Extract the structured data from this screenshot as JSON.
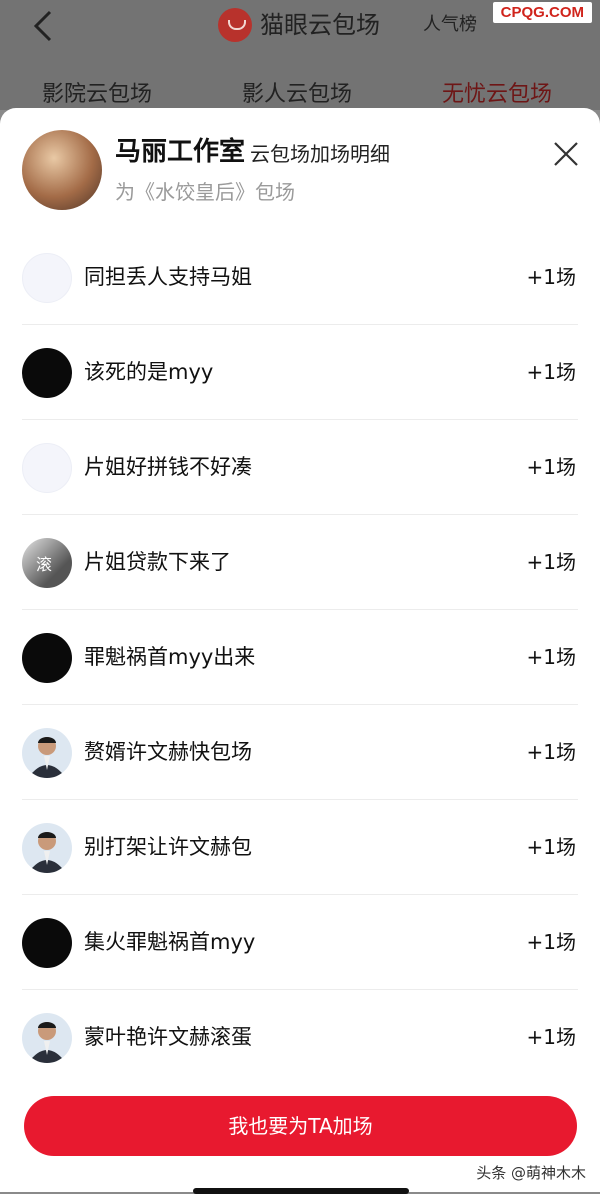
{
  "header": {
    "app_title": "猫眼云包场",
    "popularity_rank": "人气榜",
    "watermark": "CPQG.COM"
  },
  "tabs": [
    {
      "label": "影院云包场"
    },
    {
      "label": "影人云包场"
    },
    {
      "label": "无忧云包场"
    }
  ],
  "sheet": {
    "studio_name": "马丽工作室",
    "subtitle": "云包场加场明细",
    "movie": "为《水饺皇后》包场",
    "rows": [
      {
        "name": "同担丢人支持马姐",
        "count": "+1场",
        "avatar": "white"
      },
      {
        "name": "该死的是myy",
        "count": "+1场",
        "avatar": "black"
      },
      {
        "name": "片姐好拼钱不好凑",
        "count": "+1场",
        "avatar": "white"
      },
      {
        "name": "片姐贷款下来了",
        "count": "+1场",
        "avatar": "gray"
      },
      {
        "name": "罪魁祸首myy出来",
        "count": "+1场",
        "avatar": "black"
      },
      {
        "name": "赘婿许文赫快包场",
        "count": "+1场",
        "avatar": "person"
      },
      {
        "name": "别打架让许文赫包",
        "count": "+1场",
        "avatar": "person"
      },
      {
        "name": "集火罪魁祸首myy",
        "count": "+1场",
        "avatar": "black"
      },
      {
        "name": "蒙叶艳许文赫滚蛋",
        "count": "+1场",
        "avatar": "person"
      }
    ],
    "gray_avatar_glyph": "滚",
    "cta_label": "我也要为TA加场",
    "credit": "头条 @萌神木木"
  },
  "colors": {
    "accent_red": "#e8192f",
    "header_dim": "#737373"
  }
}
